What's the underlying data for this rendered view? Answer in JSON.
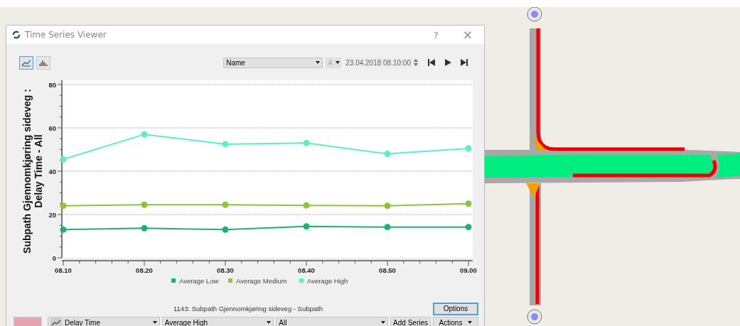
{
  "window": {
    "title": "Time Series Viewer",
    "help": "?",
    "close": "×"
  },
  "toolbar": {
    "view_buttons": [
      {
        "kind": "line",
        "selected": true
      },
      {
        "kind": "bar",
        "selected": false
      }
    ],
    "name_select": "Name",
    "attribute_select": {
      "value": "A",
      "disabled": true
    },
    "time": "23.04.2018 08.10:00"
  },
  "chart": {
    "chart_data": {
      "type": "line",
      "ylabel": "Subpath Gjennomkjøring sideveg :\nDelay Time - All",
      "categories": [
        "08.10",
        "08.20",
        "08.30",
        "08.40",
        "08.50",
        "09.00"
      ],
      "ylim": [
        0,
        80
      ],
      "yticks": [
        0,
        20,
        40,
        60,
        80
      ],
      "grid": true,
      "legend": true,
      "series": [
        {
          "name": "Average Low",
          "color": "#1db36e",
          "marker": "circle",
          "values": [
            13,
            13.7,
            13,
            14.5,
            14.2,
            14.2
          ]
        },
        {
          "name": "Average Medium",
          "color": "#8cc43c",
          "marker": "circle",
          "values": [
            24,
            24.5,
            24.5,
            24.2,
            24,
            25
          ]
        },
        {
          "name": "Average High",
          "color": "#5cefbf",
          "marker": "circle",
          "values": [
            45.5,
            57,
            52.5,
            53,
            48,
            50.5
          ]
        }
      ]
    }
  },
  "caption": "1143: Subpath Gjennomkjøring sideveg - Subpath",
  "options_button": "Options",
  "bottom_bar": {
    "color": "#e8a3b3",
    "selects": [
      {
        "kind": "attribute",
        "value": "Delay Time"
      },
      {
        "kind": "plain",
        "value": "Average High"
      },
      {
        "kind": "plain",
        "value": "All"
      }
    ],
    "add_series": "Add Series",
    "actions": "Actions"
  }
}
